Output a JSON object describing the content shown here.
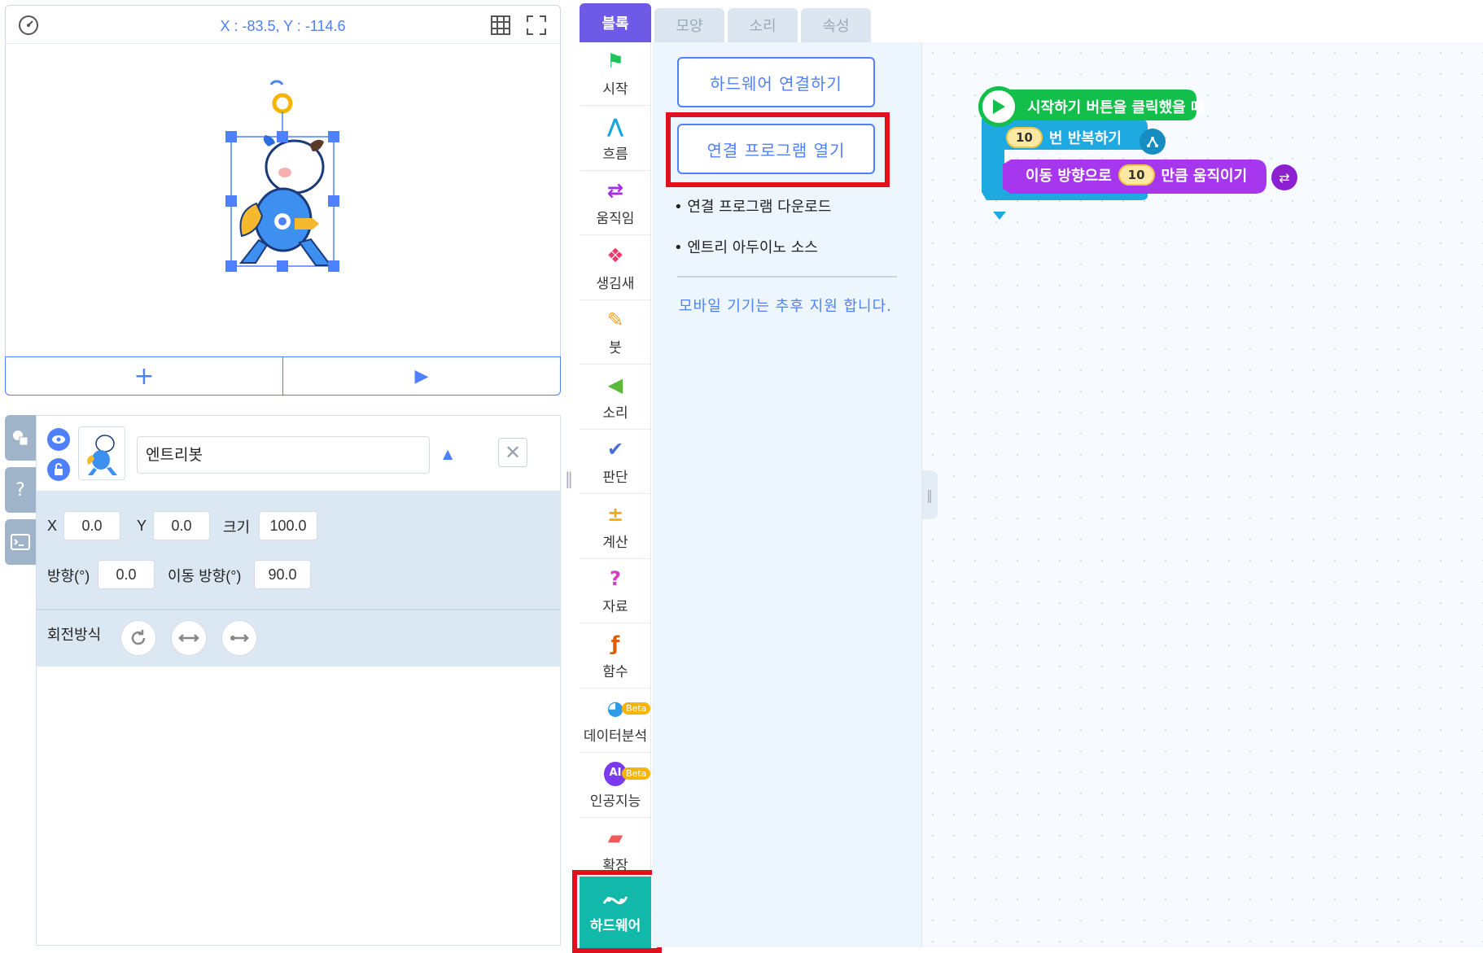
{
  "stage": {
    "coordinates": "X : -83.5, Y : -114.6",
    "add_label": "+",
    "play_label": "▶"
  },
  "object": {
    "name": "엔트리봇",
    "x_label": "X",
    "x_value": "0.0",
    "y_label": "Y",
    "y_value": "0.0",
    "size_label": "크기",
    "size_value": "100.0",
    "direction_label": "방향(°)",
    "direction_value": "0.0",
    "move_direction_label": "이동 방향(°)",
    "move_direction_value": "90.0",
    "rotation_label": "회전방식"
  },
  "tabs": [
    {
      "label": "블록",
      "active": true
    },
    {
      "label": "모양",
      "active": false
    },
    {
      "label": "소리",
      "active": false
    },
    {
      "label": "속성",
      "active": false
    }
  ],
  "categories": [
    {
      "label": "시작",
      "icon": "flag-icon",
      "glyph": "⚑",
      "color": "#20c35a"
    },
    {
      "label": "흐름",
      "icon": "flow-icon",
      "glyph": "⋀",
      "color": "#19a5e0"
    },
    {
      "label": "움직임",
      "icon": "move-icon",
      "glyph": "⇄",
      "color": "#a62bea"
    },
    {
      "label": "생김새",
      "icon": "looks-icon",
      "glyph": "❖",
      "color": "#ef3b6b"
    },
    {
      "label": "붓",
      "icon": "brush-icon",
      "glyph": "✎",
      "color": "#ff9e20"
    },
    {
      "label": "소리",
      "icon": "sound-icon",
      "glyph": "◀",
      "color": "#5ab83a"
    },
    {
      "label": "판단",
      "icon": "check-icon",
      "glyph": "✔",
      "color": "#4a6cd4"
    },
    {
      "label": "계산",
      "icon": "calc-icon",
      "glyph": "±",
      "color": "#f4a914"
    },
    {
      "label": "자료",
      "icon": "question-icon",
      "glyph": "?",
      "color": "#d43ec7"
    },
    {
      "label": "함수",
      "icon": "function-icon",
      "glyph": "ƒ",
      "color": "#de5c04"
    },
    {
      "label": "데이터분석",
      "icon": "pie-chart-icon",
      "glyph": "◕",
      "color": "#2f9ce8",
      "beta": "Beta"
    },
    {
      "label": "인공지능",
      "icon": "ai-icon",
      "glyph": "AI",
      "color": "#7a3bf0",
      "beta": "Beta"
    },
    {
      "label": "확장",
      "icon": "extension-icon",
      "glyph": "▰",
      "color": "#ef5b5b"
    }
  ],
  "hardware_category": {
    "label": "하드웨어",
    "icon": "hardware-icon"
  },
  "palette": {
    "connect_hardware": "하드웨어 연결하기",
    "open_program": "연결 프로그램 열기",
    "download_link": "연결 프로그램 다운로드",
    "arduino_link": "엔트리 아두이노 소스",
    "mobile_note": "모바일 기기는 추후 지원 합니다."
  },
  "script": {
    "start_block": "시작하기 버튼을 클릭했을 때",
    "repeat_count": "10",
    "repeat_label": "번 반복하기",
    "move_prefix": "이동 방향으로",
    "move_amount": "10",
    "move_suffix": "만큼 움직이기"
  },
  "colors": {
    "accent": "#4f80ff",
    "tab_active": "#6e5ae6",
    "hardware": "#12b8aa",
    "highlight": "#e1101e",
    "start_block": "#13bf4b",
    "flow_block": "#1ea9e1",
    "move_block": "#a737ee"
  }
}
